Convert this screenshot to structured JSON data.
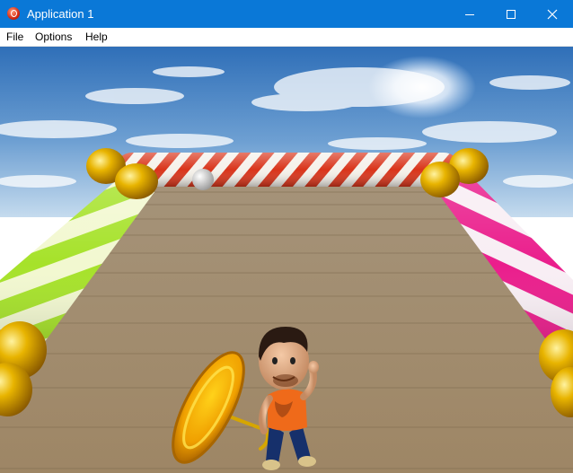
{
  "window": {
    "title": "Application 1",
    "icon": "app-logo-icon"
  },
  "controls": {
    "minimize": "minimize-icon",
    "maximize": "maximize-icon",
    "close": "close-icon"
  },
  "menu": {
    "items": [
      "File",
      "Options",
      "Help"
    ]
  },
  "scene": {
    "colors": {
      "sky_top": "#2f6fb8",
      "sky_bottom": "#bcd4ea",
      "floor": "#a68e6e",
      "rail_back": "#d9341a",
      "rail_left": "#a6e22a",
      "rail_right": "#ea1e8c",
      "gold": "#e0a800"
    }
  }
}
